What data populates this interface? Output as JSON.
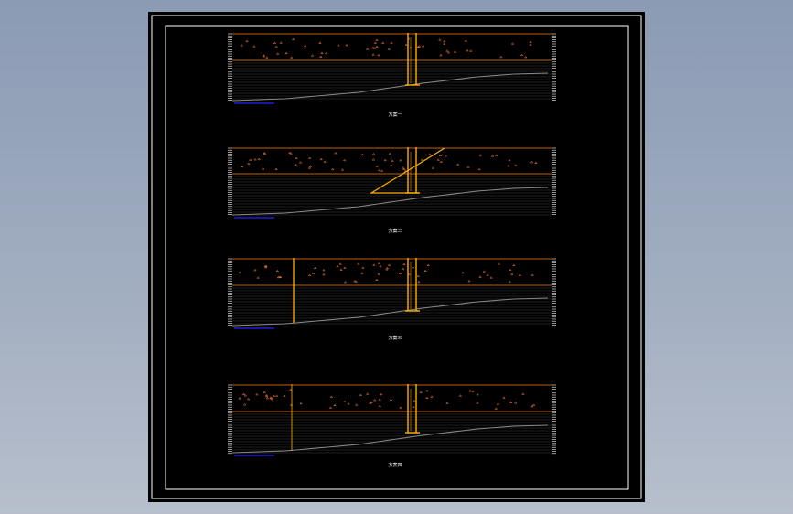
{
  "colors": {
    "background": "#000000",
    "frame": "#ffffff",
    "soil_boundary": "#ff8000",
    "pile": "#ffb000",
    "fill_dots": "#ff7a2a",
    "strata_lines": "#3c3c3c",
    "ground_profile": "#8a8a8a",
    "scale_bar": "#2424ff"
  },
  "figures": [
    {
      "caption": "方案一",
      "structure": "pile-pair"
    },
    {
      "caption": "方案二",
      "structure": "pile-pair-with-diagonal-brace"
    },
    {
      "caption": "方案三",
      "structure": "pile-pair-with-single-pile"
    },
    {
      "caption": "方案四",
      "structure": "pile-pair-with-thin-pile"
    }
  ]
}
